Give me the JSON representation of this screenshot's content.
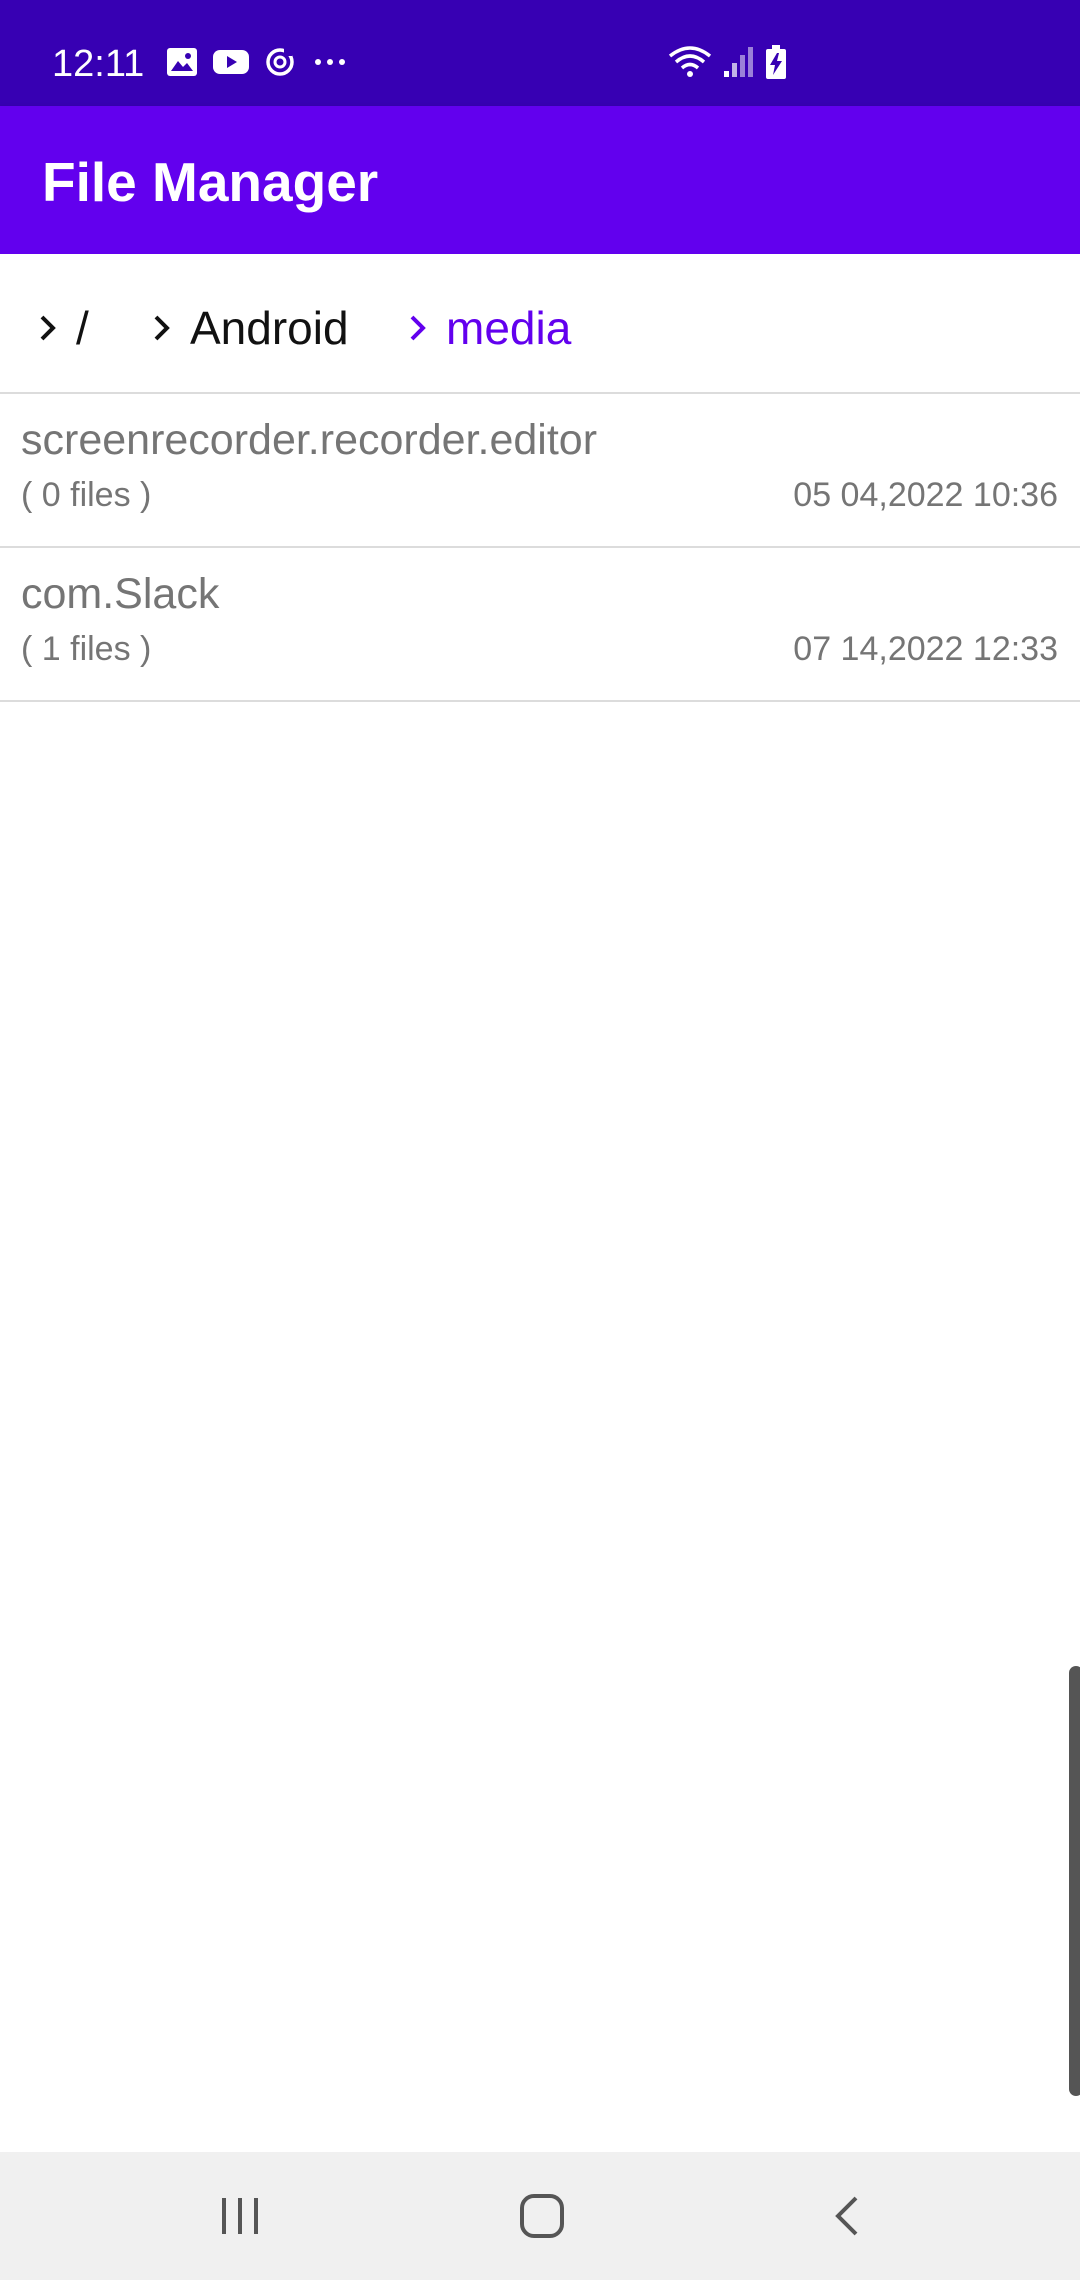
{
  "status_bar": {
    "time": "12:11",
    "left_icons": [
      "image-icon",
      "youtube-icon",
      "sync-icon",
      "more-dots-icon"
    ],
    "right_icons": [
      "wifi-icon",
      "signal-icon",
      "battery-charging-icon"
    ],
    "color": "#3700b3"
  },
  "app_bar": {
    "title": "File Manager",
    "color": "#6200ee"
  },
  "breadcrumb": {
    "items": [
      {
        "label": "/"
      },
      {
        "label": "Android"
      },
      {
        "label": "media",
        "active": true
      }
    ],
    "active_color": "#6200ee"
  },
  "files": [
    {
      "name": "screenrecorder.recorder.editor",
      "count": "( 0 files )",
      "date": "05 04,2022 10:36"
    },
    {
      "name": "com.Slack",
      "count": "( 1 files )",
      "date": "07 14,2022 12:33"
    }
  ],
  "nav_bar": {
    "buttons": [
      "recent-apps-icon",
      "home-icon",
      "back-icon"
    ]
  }
}
